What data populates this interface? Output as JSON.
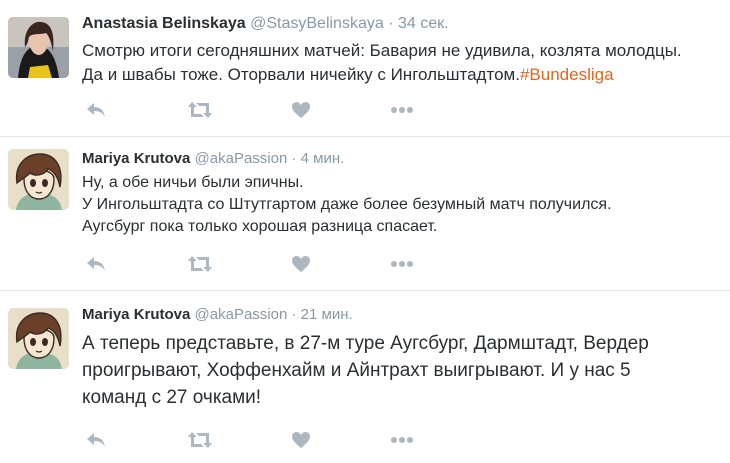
{
  "colors": {
    "icon": "#abb8c2",
    "hashtag": "#e0661f",
    "meta": "#8899a6",
    "divider": "#e1e8ed"
  },
  "tweets": [
    {
      "name": "Anastasia Belinskaya",
      "handle": "@StasyBelinskaya",
      "separator": "·",
      "time": "34 сек.",
      "lines": [
        "Смотрю итоги сегодняшних матчей: Бавария не удивила, козлята молодцы.",
        "Да и швабы тоже. Оторвали ничейку с Ингольштадтом."
      ],
      "hashtag": "#Bundesliga",
      "icons": [
        "reply-icon",
        "retweet-icon",
        "like-icon",
        "more-icon"
      ]
    },
    {
      "name": "Mariya Krutova",
      "handle": "@akaPassion",
      "separator": "·",
      "time": "4 мин.",
      "lines": [
        "Ну, а обе ничьи были эпичны.",
        "У Ингольштадта со Штутгартом даже более безумный матч получился.",
        "Аугсбург пока только хорошая разница спасает."
      ],
      "icons": [
        "reply-icon",
        "retweet-icon",
        "like-icon",
        "more-icon"
      ]
    },
    {
      "name": "Mariya Krutova",
      "handle": "@akaPassion",
      "separator": "·",
      "time": "21 мин.",
      "lines": [
        "А теперь представьте, в 27-м туре Аугсбург, Дармштадт, Вердер",
        "проигрывают, Хоффенхайм и Айнтрахт выигрывают. И у нас 5",
        "команд с 27 очками!"
      ],
      "icons": [
        "reply-icon",
        "retweet-icon",
        "like-icon",
        "more-icon"
      ]
    }
  ]
}
